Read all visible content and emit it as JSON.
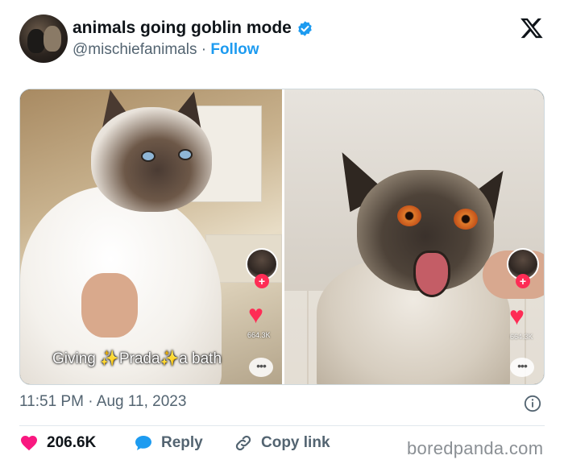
{
  "author": {
    "display_name": "animals going goblin mode",
    "handle": "@mischiefanimals",
    "separator": "·",
    "follow_label": "Follow",
    "verified": true
  },
  "media": {
    "left_panel": {
      "caption_parts": [
        "Giving",
        "✨",
        "Prada",
        "✨",
        "a bath"
      ],
      "like_count": "664.3K"
    },
    "right_panel": {
      "like_count": "664.3K"
    }
  },
  "post": {
    "time": "11:51 PM",
    "separator": "·",
    "date": "Aug 11, 2023"
  },
  "actions": {
    "like_count": "206.6K",
    "reply_label": "Reply",
    "copy_link_label": "Copy link"
  },
  "watermark": "boredpanda.com",
  "colors": {
    "accent": "#1d9bf0",
    "like": "#f91880",
    "text": "#0f1419",
    "muted": "#536471"
  },
  "icons": {
    "verified": "verified-badge-icon",
    "close": "x-logo-icon",
    "info": "info-icon",
    "like": "heart-icon",
    "reply": "speech-bubble-icon",
    "copy": "link-icon"
  }
}
